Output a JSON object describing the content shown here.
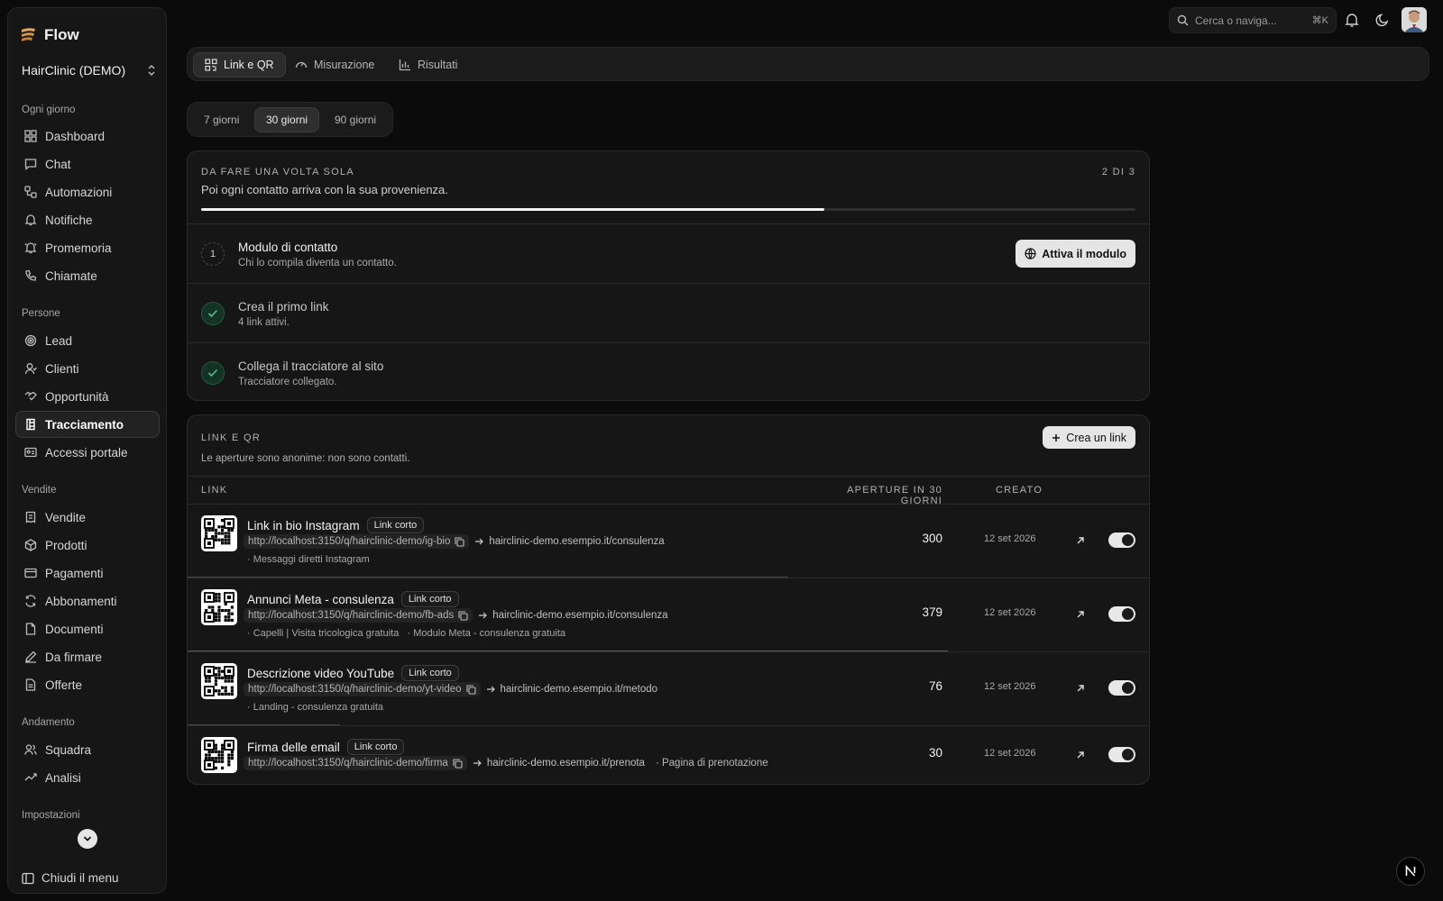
{
  "app": {
    "name": "Flow",
    "workspace": "HairClinic (DEMO)"
  },
  "sidebar": {
    "sections": [
      {
        "title": "Ogni giorno",
        "items": [
          {
            "label": "Dashboard",
            "icon": "dashboard-icon"
          },
          {
            "label": "Chat",
            "icon": "chat-icon"
          },
          {
            "label": "Automazioni",
            "icon": "workflow-icon"
          },
          {
            "label": "Notifiche",
            "icon": "bell-icon"
          },
          {
            "label": "Promemoria",
            "icon": "bell-ring-icon"
          },
          {
            "label": "Chiamate",
            "icon": "phone-icon"
          }
        ]
      },
      {
        "title": "Persone",
        "items": [
          {
            "label": "Lead",
            "icon": "target-icon"
          },
          {
            "label": "Clienti",
            "icon": "user-icon"
          },
          {
            "label": "Opportunità",
            "icon": "handshake-icon"
          },
          {
            "label": "Tracciamento",
            "icon": "tracking-icon",
            "active": true
          },
          {
            "label": "Accessi portale",
            "icon": "id-card-icon"
          }
        ]
      },
      {
        "title": "Vendite",
        "items": [
          {
            "label": "Vendite",
            "icon": "receipt-icon"
          },
          {
            "label": "Prodotti",
            "icon": "box-icon"
          },
          {
            "label": "Pagamenti",
            "icon": "credit-card-icon"
          },
          {
            "label": "Abbonamenti",
            "icon": "refresh-icon"
          },
          {
            "label": "Documenti",
            "icon": "document-icon"
          },
          {
            "label": "Da firmare",
            "icon": "pen-icon"
          },
          {
            "label": "Offerte",
            "icon": "file-text-icon"
          }
        ]
      },
      {
        "title": "Andamento",
        "items": [
          {
            "label": "Squadra",
            "icon": "users-icon"
          },
          {
            "label": "Analisi",
            "icon": "chart-icon"
          }
        ]
      },
      {
        "title": "Impostazioni",
        "items": []
      }
    ],
    "close_label": "Chiudi il menu"
  },
  "topbar": {
    "search_placeholder": "Cerca o naviga...",
    "shortcut": "⌘K"
  },
  "tabs": [
    {
      "label": "Link e QR",
      "icon": "qr-icon",
      "active": true
    },
    {
      "label": "Misurazione",
      "icon": "gauge-icon"
    },
    {
      "label": "Risultati",
      "icon": "bar-chart-icon"
    }
  ],
  "range": [
    {
      "label": "7 giorni"
    },
    {
      "label": "30 giorni",
      "active": true
    },
    {
      "label": "90 giorni"
    }
  ],
  "setup": {
    "eyebrow": "DA FARE UNA VOLTA SOLA",
    "subtitle": "Poi ogni contatto arriva con la sua provenienza.",
    "counter": "2 DI 3",
    "progress": 0.667,
    "steps": [
      {
        "number": "1",
        "title": "Modulo di contatto",
        "desc": "Chi lo compila diventa un contatto.",
        "done": false,
        "action": "Attiva il modulo"
      },
      {
        "title": "Crea il primo link",
        "desc": "4 link attivi.",
        "done": true
      },
      {
        "title": "Collega il tracciatore al sito",
        "desc": "Tracciatore collegato.",
        "done": true
      }
    ]
  },
  "links": {
    "eyebrow": "LINK E QR",
    "subtitle": "Le aperture sono anonime: non sono contatti.",
    "create_label": "Crea un link",
    "columns": {
      "link": "LINK",
      "opens": "APERTURE IN 30 GIORNI",
      "created": "CREATO"
    },
    "rows": [
      {
        "title": "Link in bio Instagram",
        "badge": "Link corto",
        "url": "http://localhost:3150/q/hairclinic-demo/ig-bio",
        "dest": "hairclinic-demo.esempio.it/consulenza",
        "tags": "· Messaggi diretti Instagram",
        "opens": "300",
        "opens_share": 0.79,
        "created": "12 set 2026",
        "enabled": true
      },
      {
        "title": "Annunci Meta - consulenza",
        "badge": "Link corto",
        "url": "http://localhost:3150/q/hairclinic-demo/fb-ads",
        "dest": "hairclinic-demo.esempio.it/consulenza",
        "tags": "· Capelli | Visita tricologica gratuita   · Modulo Meta - consulenza gratuita",
        "opens": "379",
        "opens_share": 1.0,
        "created": "12 set 2026",
        "enabled": true
      },
      {
        "title": "Descrizione video YouTube",
        "badge": "Link corto",
        "url": "http://localhost:3150/q/hairclinic-demo/yt-video",
        "dest": "hairclinic-demo.esempio.it/metodo",
        "tags": "· Landing - consulenza gratuita",
        "opens": "76",
        "opens_share": 0.2,
        "created": "12 set 2026",
        "enabled": true
      },
      {
        "title": "Firma delle email",
        "badge": "Link corto",
        "url": "http://localhost:3150/q/hairclinic-demo/firma",
        "dest": "hairclinic-demo.esempio.it/prenota",
        "dest_tag": "· Pagina di prenotazione",
        "opens": "30",
        "opens_share": 0.08,
        "created": "12 set 2026",
        "enabled": true
      }
    ]
  }
}
